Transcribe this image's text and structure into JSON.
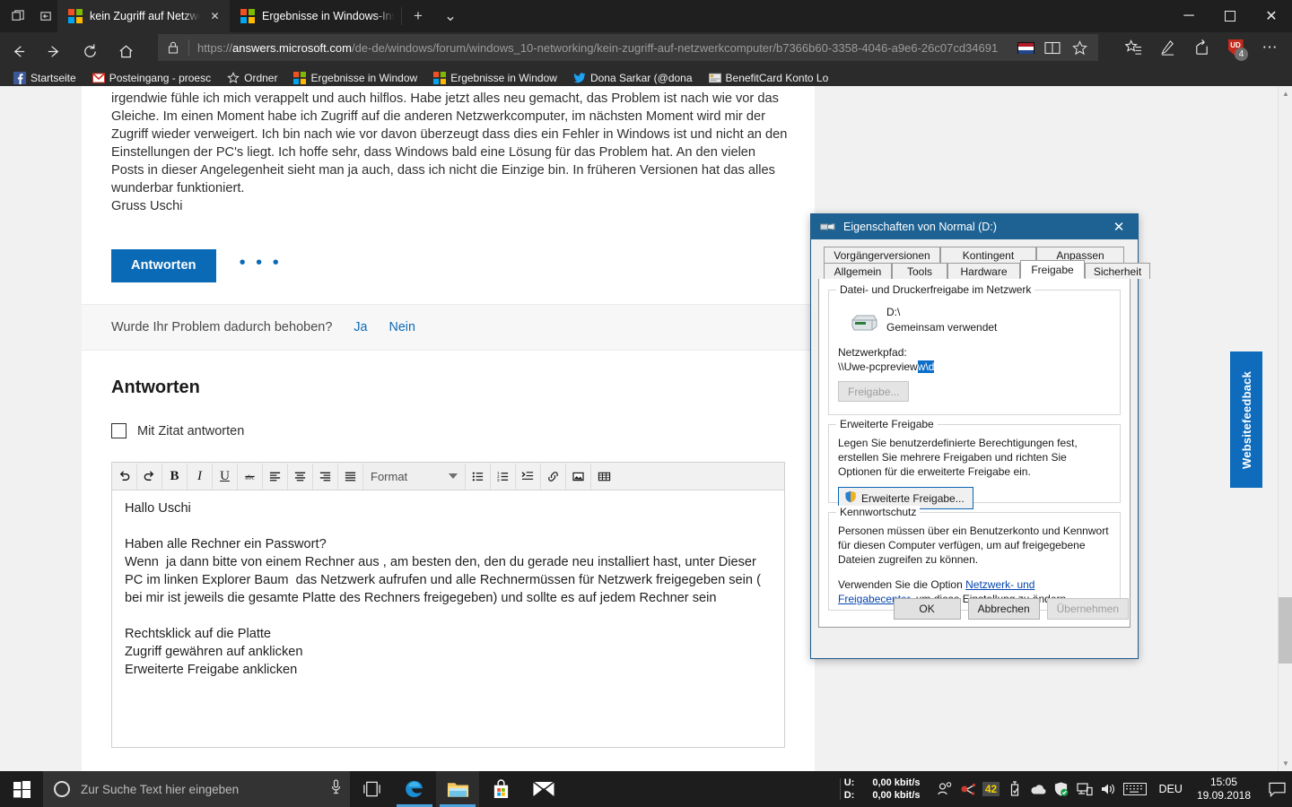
{
  "browser": {
    "system_buttons": [
      {
        "name": "restore-tabs-icon",
        "glyph": "tabs"
      },
      {
        "name": "set-tabs-aside-icon",
        "glyph": "aside"
      }
    ],
    "tabs": [
      {
        "title": "kein Zugriff auf Netzwer",
        "favicon": "microsoft-logo",
        "active": true,
        "close_label": "✕"
      },
      {
        "title": "Ergebnisse in Windows-Insi",
        "favicon": "microsoft-logo",
        "active": false,
        "close_label": ""
      }
    ],
    "new_tab_label": "+",
    "tab_menu_label": "⌄",
    "window_controls": {
      "minimize": "─",
      "restore": "❐",
      "close": "✕"
    },
    "nav": {
      "back": "←",
      "forward": "→",
      "refresh": "↻",
      "home": "⌂"
    },
    "address": {
      "lock_icon": "lock-icon",
      "url_prefix": "https://",
      "url_domain": "answers.microsoft.com",
      "url_path": "/de-de/windows/forum/windows_10-networking/kein-zugriff-auf-netzwerkcomputer/b7366b60-3358-4046-a9e6-26c07cd34691",
      "flag": "nl",
      "reading_view_label": "reading-view-icon",
      "favorite_label": "star-icon"
    },
    "toolbar_right": {
      "favorites_hub": "favorites-hub-icon",
      "notes": "web-notes-icon",
      "share": "share-icon",
      "extension_badge_text": "UD",
      "extension_badge_count": "4",
      "more": "⋯"
    },
    "bookmarks": [
      {
        "label": "Startseite",
        "icon": "facebook-icon"
      },
      {
        "label": "Posteingang - proesc",
        "icon": "gmail-icon"
      },
      {
        "label": "Ordner",
        "icon": "star-outline-icon"
      },
      {
        "label": "Ergebnisse in Window",
        "icon": "microsoft-logo"
      },
      {
        "label": "Ergebnisse in Window",
        "icon": "microsoft-logo"
      },
      {
        "label": "Dona Sarkar (@dona",
        "icon": "twitter-icon"
      },
      {
        "label": "BenefitCard Konto Lo",
        "icon": "card-icon"
      }
    ]
  },
  "page": {
    "post_body": "irgendwie fühle ich mich verappelt und auch hilflos. Habe jetzt alles neu gemacht, das Problem ist nach wie vor das Gleiche. Im einen Moment habe ich Zugriff auf die anderen Netzwerkcomputer, im nächsten Moment wird mir der Zugriff wieder verweigert. Ich bin nach wie vor davon überzeugt dass dies ein Fehler in Windows ist und nicht an den Einstellungen der PC's liegt. Ich hoffe sehr, dass Windows bald eine Lösung für das Problem hat. An den vielen Posts in dieser Angelegenheit sieht man ja auch, dass ich nicht die Einzige bin. In früheren Versionen hat das alles wunderbar funktioniert.",
    "post_signature": "Gruss Uschi",
    "reply_button": "Antworten",
    "more_actions": "• • •",
    "resolve_question": "Wurde Ihr Problem dadurch behoben?",
    "resolve_yes": "Ja",
    "resolve_no": "Nein",
    "answers_heading": "Antworten",
    "quote_checkbox_label": "Mit Zitat antworten",
    "editor": {
      "buttons": [
        {
          "name": "undo-icon",
          "glyph": "↶"
        },
        {
          "name": "redo-icon",
          "glyph": "↷"
        },
        {
          "name": "bold-icon",
          "glyph": "B"
        },
        {
          "name": "italic-icon",
          "glyph": "I"
        },
        {
          "name": "underline-icon",
          "glyph": "U"
        },
        {
          "name": "strikethrough-icon",
          "glyph": "abc"
        },
        {
          "name": "align-left-icon",
          "glyph": "align-left"
        },
        {
          "name": "align-center-icon",
          "glyph": "align-center"
        },
        {
          "name": "align-right-icon",
          "glyph": "align-right"
        },
        {
          "name": "align-justify-icon",
          "glyph": "align-justify"
        }
      ],
      "format_select": "Format",
      "buttons_right": [
        {
          "name": "bullet-list-icon",
          "glyph": "bullets"
        },
        {
          "name": "numbered-list-icon",
          "glyph": "numbers"
        },
        {
          "name": "indent-icon",
          "glyph": "indent"
        },
        {
          "name": "link-icon",
          "glyph": "link"
        },
        {
          "name": "image-icon",
          "glyph": "image"
        },
        {
          "name": "table-icon",
          "glyph": "table"
        }
      ],
      "body": "Hallo Uschi\n\nHaben alle Rechner ein Passwort?\nWenn  ja dann bitte von einem Rechner aus , am besten den, den du gerade neu installiert hast, unter Dieser PC im linken Explorer Baum  das Netzwerk aufrufen und alle Rechnermüssen für Netzwerk freigegeben sein ( bei mir ist jeweils die gesamte Platte des Rechners freigegeben) und sollte es auf jedem Rechner sein\n\nRechtsklick auf die Platte\nZugriff gewähren auf anklicken\nErweiterte Freigabe anklicken"
    },
    "feedback_tab": "Websitefeedback"
  },
  "dialog": {
    "title": "Eigenschaften von Normal (D:)",
    "close_label": "✕",
    "tabs_row1": [
      "Vorgängerversionen",
      "Kontingent",
      "Anpassen"
    ],
    "tabs_row2": [
      "Allgemein",
      "Tools",
      "Hardware",
      "Freigabe",
      "Sicherheit"
    ],
    "selected_tab": "Freigabe",
    "share_group": {
      "legend": "Datei- und Druckerfreigabe im Netzwerk",
      "drive_name": "D:\\",
      "drive_state": "Gemeinsam verwendet",
      "netpath_label": "Netzwerkpfad:",
      "netpath_value": "\\\\Uwe-pcpreview",
      "netpath_selected": "w\\d",
      "share_button": "Freigabe..."
    },
    "advanced_group": {
      "legend": "Erweiterte Freigabe",
      "description": "Legen Sie benutzerdefinierte Berechtigungen fest, erstellen Sie mehrere Freigaben und richten Sie Optionen für die erweiterte Freigabe ein.",
      "button": "Erweiterte Freigabe..."
    },
    "password_group": {
      "legend": "Kennwortschutz",
      "paragraph1": "Personen müssen über ein Benutzerkonto und Kennwort für diesen Computer verfügen, um auf freigegebene Dateien zugreifen zu können.",
      "paragraph2_before": "Verwenden Sie die Option ",
      "paragraph2_link": "Netzwerk- und Freigabecenter",
      "paragraph2_after": ", um diese Einstellung zu ändern."
    },
    "buttons": {
      "ok": "OK",
      "cancel": "Abbrechen",
      "apply": "Übernehmen"
    }
  },
  "taskbar": {
    "start_label": "start-icon",
    "search_placeholder": "Zur Suche Text hier eingeben",
    "mic_icon": "microphone-icon",
    "icons": [
      {
        "name": "task-view-icon"
      },
      {
        "name": "edge-browser-icon"
      },
      {
        "name": "file-explorer-icon"
      },
      {
        "name": "microsoft-store-icon"
      },
      {
        "name": "mail-icon"
      }
    ],
    "network_meter": {
      "up_label": "U:",
      "down_label": "D:",
      "up_value": "0,00 kbit/s",
      "down_value": "0,00 kbit/s"
    },
    "tray": [
      {
        "name": "people-icon"
      },
      {
        "name": "bluetooth-device-icon"
      },
      {
        "name": "temperature-badge",
        "text": "42"
      },
      {
        "name": "usb-eject-icon"
      },
      {
        "name": "onedrive-icon"
      },
      {
        "name": "windows-defender-icon"
      },
      {
        "name": "network-icon"
      },
      {
        "name": "volume-icon"
      },
      {
        "name": "keyboard-icon"
      }
    ],
    "language": "DEU",
    "time": "15:05",
    "date": "19.09.2018",
    "notification_icon": "action-center-icon"
  }
}
